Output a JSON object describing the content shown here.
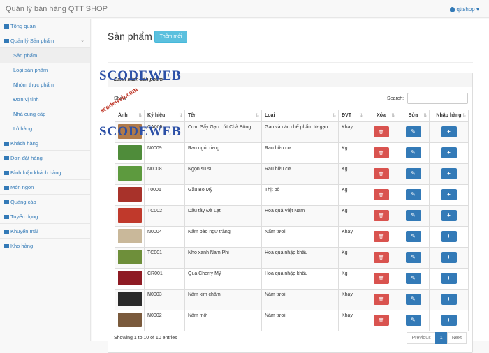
{
  "app": {
    "title": "Quản lý bán hàng QTT SHOP",
    "user": "qttshop"
  },
  "sidebar": {
    "items": [
      {
        "label": "Tổng quan",
        "sub": false
      },
      {
        "label": "Quản lý Sản phẩm",
        "sub": false,
        "expanded": true
      },
      {
        "label": "Sản phẩm",
        "sub": true,
        "active": true
      },
      {
        "label": "Loại sản phẩm",
        "sub": true
      },
      {
        "label": "Nhóm thực phẩm",
        "sub": true
      },
      {
        "label": "Đơn vị tính",
        "sub": true
      },
      {
        "label": "Nhà cung cấp",
        "sub": true
      },
      {
        "label": "Lô hàng",
        "sub": true
      },
      {
        "label": "Khách hàng",
        "sub": false
      },
      {
        "label": "Đơn đặt hàng",
        "sub": false
      },
      {
        "label": "Bình luận khách hàng",
        "sub": false
      },
      {
        "label": "Món ngon",
        "sub": false
      },
      {
        "label": "Quảng cáo",
        "sub": false
      },
      {
        "label": "Tuyển dụng",
        "sub": false
      },
      {
        "label": "Khuyến mãi",
        "sub": false
      },
      {
        "label": "Kho hàng",
        "sub": false
      }
    ]
  },
  "page": {
    "title": "Sản phẩm /",
    "new_button": "Thêm mới"
  },
  "panel": {
    "title": "Danh sách sản phẩm",
    "show_label": "Show",
    "search_label": "Search:"
  },
  "table": {
    "headers": [
      "Ảnh",
      "Ký hiệu",
      "Tên",
      "Loại",
      "ĐVT",
      "Xóa",
      "Sửa",
      "Nhập hàng"
    ],
    "rows": [
      {
        "code": "CA005",
        "name": "Cơm Sấy Gạo Lứt Chà Bông",
        "type": "Gạo và các chế phẩm từ gạo",
        "unit": "Khay",
        "color": "#b07a4a"
      },
      {
        "code": "N0009",
        "name": "Rau ngót rừng",
        "type": "Rau hữu cơ",
        "unit": "Kg",
        "color": "#4f8c3a"
      },
      {
        "code": "N0008",
        "name": "Ngọn su su",
        "type": "Rau hữu cơ",
        "unit": "Kg",
        "color": "#5d9a3e"
      },
      {
        "code": "T0001",
        "name": "Gầu Bò Mỹ",
        "type": "Thịt bò",
        "unit": "Kg",
        "color": "#a8322a"
      },
      {
        "code": "TC002",
        "name": "Dâu tây Đà Lạt",
        "type": "Hoa quả Việt Nam",
        "unit": "Kg",
        "color": "#c0392b"
      },
      {
        "code": "N0004",
        "name": "Nấm bào ngư trắng",
        "type": "Nấm tươi",
        "unit": "Khay",
        "color": "#c9b89a"
      },
      {
        "code": "TC001",
        "name": "Nho xanh Nam Phi",
        "type": "Hoa quả nhập khẩu",
        "unit": "Kg",
        "color": "#6e8f3a"
      },
      {
        "code": "CR001",
        "name": "Quả Cherry Mỹ",
        "type": "Hoa quả nhập khẩu",
        "unit": "Kg",
        "color": "#8e1b24"
      },
      {
        "code": "N0003",
        "name": "Nấm kim châm",
        "type": "Nấm tươi",
        "unit": "Khay",
        "color": "#2a2a2a"
      },
      {
        "code": "N0002",
        "name": "Nấm mỡ",
        "type": "Nấm tươi",
        "unit": "Khay",
        "color": "#7a5a3c"
      }
    ]
  },
  "footer": {
    "info": "Showing 1 to 10 of 10 entries",
    "prev": "Previous",
    "page": "1",
    "next": "Next"
  },
  "watermark": {
    "text": "SCODEWEB",
    "diag": "scodeweb.com"
  },
  "colors": {
    "danger": "#d9534f",
    "primary": "#337ab7",
    "info": "#5bc0de"
  }
}
